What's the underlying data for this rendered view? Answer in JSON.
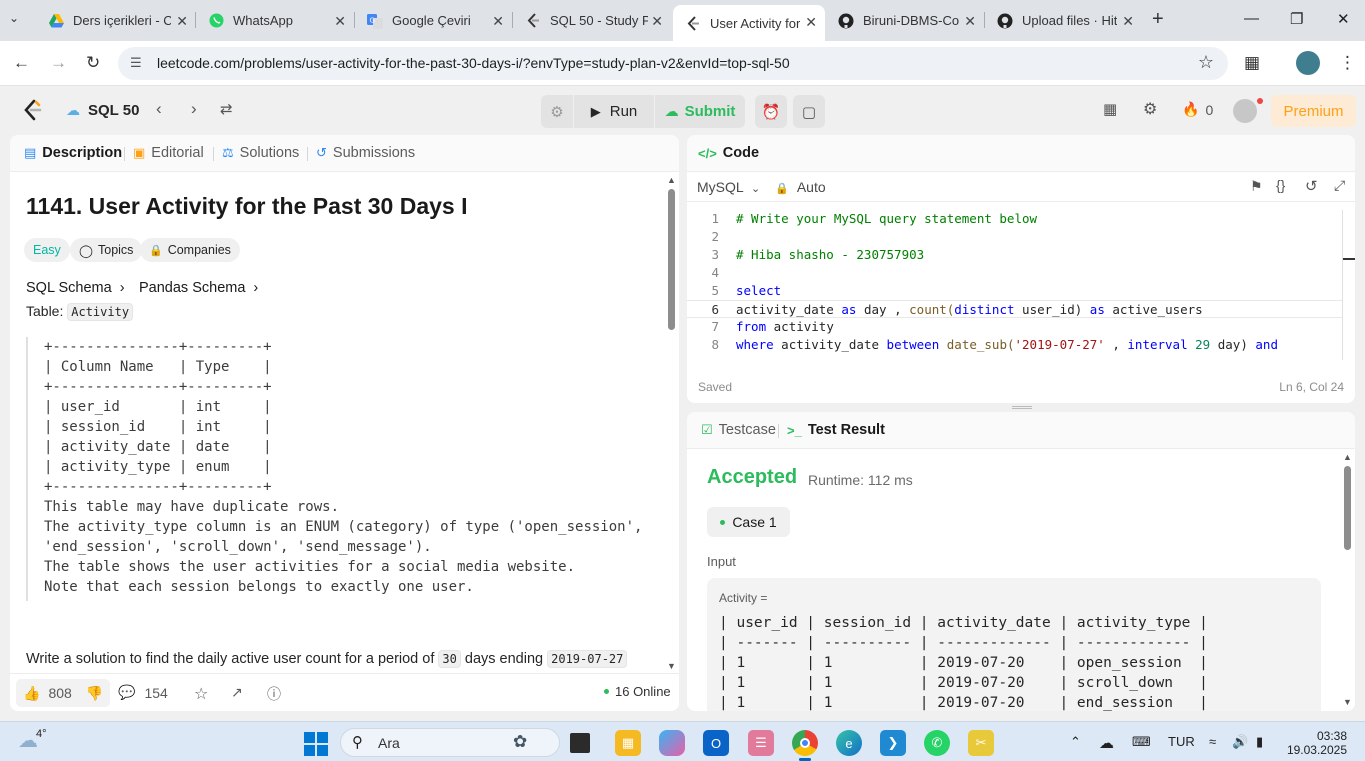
{
  "browser": {
    "tabs": [
      {
        "title": "Ders içerikleri - C",
        "icon": "google-drive-icon"
      },
      {
        "title": "WhatsApp",
        "icon": "whatsapp-icon"
      },
      {
        "title": "Google Çeviri",
        "icon": "google-translate-icon"
      },
      {
        "title": "SQL 50 - Study P",
        "icon": "leetcode-icon"
      },
      {
        "title": "User Activity for",
        "icon": "leetcode-icon"
      },
      {
        "title": "Biruni-DBMS-Co",
        "icon": "github-icon"
      },
      {
        "title": "Upload files · Hit",
        "icon": "github-icon"
      }
    ],
    "url": "leetcode.com/problems/user-activity-for-the-past-30-days-i/?envType=study-plan-v2&envId=top-sql-50"
  },
  "lc_header": {
    "study_plan": "SQL 50",
    "run_label": "Run",
    "submit_label": "Submit",
    "streak_count": "0",
    "premium_label": "Premium"
  },
  "description_panel": {
    "tabs": [
      "Description",
      "Editorial",
      "Solutions",
      "Submissions"
    ],
    "title": "1141. User Activity for the Past 30 Days I",
    "difficulty": "Easy",
    "topics_label": "Topics",
    "companies_label": "Companies",
    "sql_schema_label": "SQL Schema",
    "pandas_schema_label": "Pandas Schema",
    "table_prefix": "Table:",
    "table_name": "Activity",
    "schema_lines": [
      "+---------------+---------+",
      "| Column Name   | Type    |",
      "+---------------+---------+",
      "| user_id       | int     |",
      "| session_id    | int     |",
      "| activity_date | date    |",
      "| activity_type | enum    |",
      "+---------------+---------+",
      "This table may have duplicate rows.",
      "The activity_type column is an ENUM (category) of type ('open_session',",
      "'end_session', 'scroll_down', 'send_message').",
      "The table shows the user activities for a social media website.",
      "Note that each session belongs to exactly one user."
    ],
    "task_text": "Write a solution to find the daily active user count for a period of",
    "task_days": "30",
    "task_mid": "days ending",
    "task_date": "2019-07-27",
    "likes": "808",
    "comments": "154",
    "online": "16 Online"
  },
  "code_panel": {
    "title": "Code",
    "language": "MySQL",
    "auto_label": "Auto",
    "status": "Saved",
    "cursor_position": "Ln 6, Col 24",
    "lines": [
      "1",
      "2",
      "3",
      "4",
      "5",
      "6",
      "7",
      "8"
    ],
    "code": {
      "l1": "# Write your MySQL query statement below",
      "l3": "# Hiba shasho - 230757903",
      "l5": "select",
      "l6_a": "activity_date",
      "l6_b": "as",
      "l6_c": "day ,",
      "l6_d": "count(",
      "l6_e": "distinct",
      "l6_f": "user_id)",
      "l6_g": "as",
      "l6_h": "active_users",
      "l7_a": "from",
      "l7_b": "activity",
      "l8_a": "where",
      "l8_b": "activity_date",
      "l8_c": "between",
      "l8_d": "date_sub(",
      "l8_e": "'2019-07-27'",
      "l8_f": ",",
      "l8_g": "interval",
      "l8_h": "29",
      "l8_i": "day)",
      "l8_j": "and"
    }
  },
  "result_panel": {
    "tabs": [
      "Testcase",
      "Test Result"
    ],
    "verdict": "Accepted",
    "runtime": "Runtime: 112 ms",
    "case_label": "Case 1",
    "input_label": "Input",
    "table_name": "Activity =",
    "table_lines": [
      "| user_id | session_id | activity_date | activity_type |",
      "| ------- | ---------- | ------------- | ------------- |",
      "| 1       | 1          | 2019-07-20    | open_session  |",
      "| 1       | 1          | 2019-07-20    | scroll_down   |",
      "| 1       | 1          | 2019-07-20    | end_session   |"
    ]
  },
  "taskbar": {
    "weather": "4°",
    "search_placeholder": "Ara",
    "language": "TUR",
    "time": "03:38",
    "date": "19.03.2025"
  },
  "colors": {
    "accent_orange": "#ffa116",
    "accepted_green": "#2cbb5d",
    "easy_teal": "#00b8a3"
  }
}
